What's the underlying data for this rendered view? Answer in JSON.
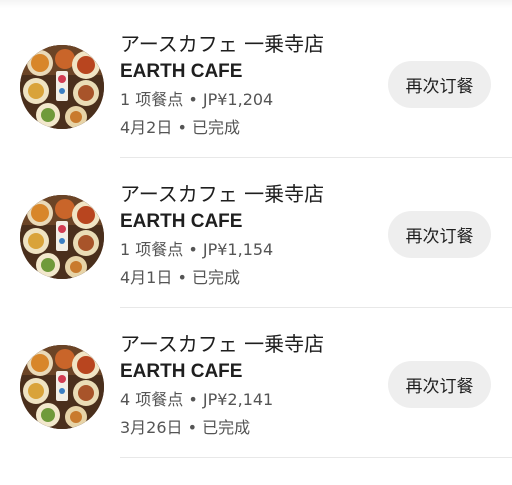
{
  "orders": [
    {
      "store_name_jp": "アースカフェ 一乗寺店",
      "store_name_en": "EARTH CAFE",
      "summary": "1 项餐点 • JP¥1,204",
      "status_line": "4月2日 • 已完成",
      "reorder_label": "再次订餐",
      "thumbnail_icon": "food-platter-image"
    },
    {
      "store_name_jp": "アースカフェ 一乗寺店",
      "store_name_en": "EARTH CAFE",
      "summary": "1 项餐点 • JP¥1,154",
      "status_line": "4月1日 • 已完成",
      "reorder_label": "再次订餐",
      "thumbnail_icon": "food-platter-image"
    },
    {
      "store_name_jp": "アースカフェ 一乗寺店",
      "store_name_en": "EARTH CAFE",
      "summary": "4 项餐点 • JP¥2,141",
      "status_line": "3月26日 • 已完成",
      "reorder_label": "再次订餐",
      "thumbnail_icon": "food-platter-image"
    }
  ],
  "colors": {
    "button_bg": "#eeeeee",
    "primary_text": "#1f1f1f",
    "secondary_text": "#555555",
    "divider": "#e8e8e8"
  }
}
